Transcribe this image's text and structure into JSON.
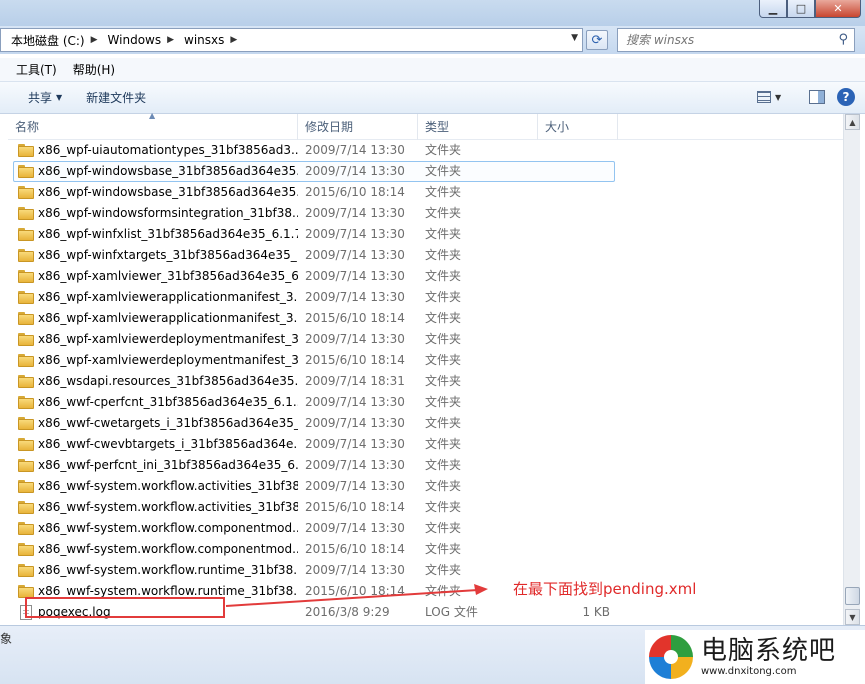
{
  "window": {
    "min": "▁",
    "max": "□",
    "close": "✕"
  },
  "address": {
    "crumbs": [
      "本地磁盘 (C:)",
      "Windows",
      "winsxs"
    ]
  },
  "search": {
    "placeholder": "搜索 winsxs"
  },
  "menu": [
    "工具(T)",
    "帮助(H)"
  ],
  "toolbar": {
    "share": "共享",
    "new_folder": "新建文件夹"
  },
  "columns": {
    "name": "名称",
    "date": "修改日期",
    "type": "类型",
    "size": "大小"
  },
  "files": [
    {
      "name": "x86_wpf-uiautomationtypes_31bf3856ad3...",
      "date": "2009/7/14 13:30",
      "type": "文件夹",
      "size": ""
    },
    {
      "name": "x86_wpf-windowsbase_31bf3856ad364e35...",
      "date": "2009/7/14 13:30",
      "type": "文件夹",
      "size": ""
    },
    {
      "name": "x86_wpf-windowsbase_31bf3856ad364e35...",
      "date": "2015/6/10 18:14",
      "type": "文件夹",
      "size": ""
    },
    {
      "name": "x86_wpf-windowsformsintegration_31bf38...",
      "date": "2009/7/14 13:30",
      "type": "文件夹",
      "size": ""
    },
    {
      "name": "x86_wpf-winfxlist_31bf3856ad364e35_6.1.7...",
      "date": "2009/7/14 13:30",
      "type": "文件夹",
      "size": ""
    },
    {
      "name": "x86_wpf-winfxtargets_31bf3856ad364e35_...",
      "date": "2009/7/14 13:30",
      "type": "文件夹",
      "size": ""
    },
    {
      "name": "x86_wpf-xamlviewer_31bf3856ad364e35_6...",
      "date": "2009/7/14 13:30",
      "type": "文件夹",
      "size": ""
    },
    {
      "name": "x86_wpf-xamlviewerapplicationmanifest_3...",
      "date": "2009/7/14 13:30",
      "type": "文件夹",
      "size": ""
    },
    {
      "name": "x86_wpf-xamlviewerapplicationmanifest_3...",
      "date": "2015/6/10 18:14",
      "type": "文件夹",
      "size": ""
    },
    {
      "name": "x86_wpf-xamlviewerdeploymentmanifest_3...",
      "date": "2009/7/14 13:30",
      "type": "文件夹",
      "size": ""
    },
    {
      "name": "x86_wpf-xamlviewerdeploymentmanifest_3...",
      "date": "2015/6/10 18:14",
      "type": "文件夹",
      "size": ""
    },
    {
      "name": "x86_wsdapi.resources_31bf3856ad364e35...",
      "date": "2009/7/14 18:31",
      "type": "文件夹",
      "size": ""
    },
    {
      "name": "x86_wwf-cperfcnt_31bf3856ad364e35_6.1....",
      "date": "2009/7/14 13:30",
      "type": "文件夹",
      "size": ""
    },
    {
      "name": "x86_wwf-cwetargets_i_31bf3856ad364e35_...",
      "date": "2009/7/14 13:30",
      "type": "文件夹",
      "size": ""
    },
    {
      "name": "x86_wwf-cwevbtargets_i_31bf3856ad364e...",
      "date": "2009/7/14 13:30",
      "type": "文件夹",
      "size": ""
    },
    {
      "name": "x86_wwf-perfcnt_ini_31bf3856ad364e35_6....",
      "date": "2009/7/14 13:30",
      "type": "文件夹",
      "size": ""
    },
    {
      "name": "x86_wwf-system.workflow.activities_31bf38...",
      "date": "2009/7/14 13:30",
      "type": "文件夹",
      "size": ""
    },
    {
      "name": "x86_wwf-system.workflow.activities_31bf38...",
      "date": "2015/6/10 18:14",
      "type": "文件夹",
      "size": ""
    },
    {
      "name": "x86_wwf-system.workflow.componentmod...",
      "date": "2009/7/14 13:30",
      "type": "文件夹",
      "size": ""
    },
    {
      "name": "x86_wwf-system.workflow.componentmod...",
      "date": "2015/6/10 18:14",
      "type": "文件夹",
      "size": ""
    },
    {
      "name": "x86_wwf-system.workflow.runtime_31bf38...",
      "date": "2009/7/14 13:30",
      "type": "文件夹",
      "size": ""
    },
    {
      "name": "x86_wwf-system.workflow.runtime_31bf38...",
      "date": "2015/6/10 18:14",
      "type": "文件夹",
      "size": ""
    },
    {
      "name": "poqexec.log",
      "date": "2016/3/8 9:29",
      "type": "LOG 文件",
      "size": "1 KB",
      "kind": "file"
    }
  ],
  "selected_index": 1,
  "annotation": {
    "text": "在最下面找到pending.xml",
    "color": "#e02a2a"
  },
  "status_fragment": "象",
  "watermark": {
    "title": "电脑系统吧",
    "url": "www.dnxitong.com"
  }
}
